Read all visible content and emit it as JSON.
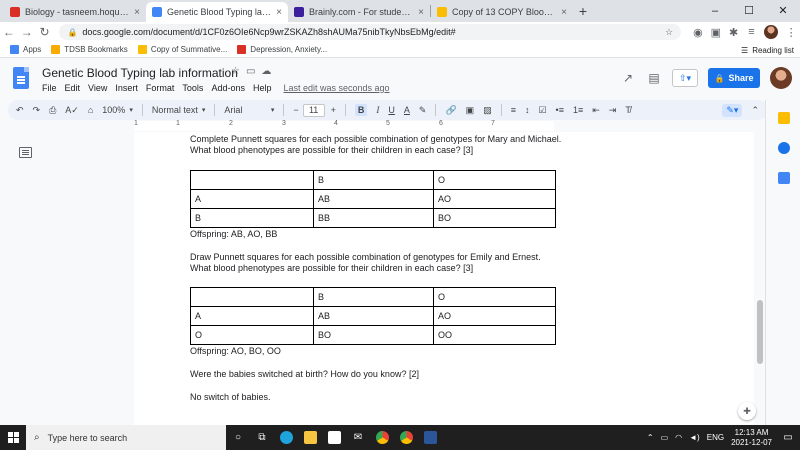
{
  "browser": {
    "tabs": [
      {
        "title": "Biology - tasneem.hoque@stude...",
        "active": false,
        "favicon_color": "#d93025"
      },
      {
        "title": "Genetic Blood Typing lab inform...",
        "active": true,
        "favicon_color": "#4285f4"
      },
      {
        "title": "Brainly.com - For students. By st...",
        "active": false,
        "favicon_color": "#3b1f9c"
      },
      {
        "title": "Copy of 13 COPY Blood typing la...",
        "active": false,
        "favicon_color": "#fbbc04"
      }
    ],
    "close_glyph": "×",
    "new_tab_glyph": "+",
    "window_controls": [
      "–",
      "☐",
      "✕"
    ],
    "url": "docs.google.com/document/d/1CF0z6OIe6Ncp9wrZSKAZh8shAUMa75nibTkyNbsEbMg/edit#",
    "bookmarks": [
      {
        "label": "Apps",
        "icon_color": "#4285f4"
      },
      {
        "label": "TDSB Bookmarks",
        "icon_color": "#f9ab00"
      },
      {
        "label": "Copy of Summative...",
        "icon_color": "#fbbc04"
      },
      {
        "label": "Depression, Anxiety...",
        "icon_color": "#d93025"
      }
    ],
    "reading_list": "Reading list"
  },
  "docs": {
    "title": "Genetic Blood Typing lab information",
    "menu": [
      "File",
      "Edit",
      "View",
      "Insert",
      "Format",
      "Tools",
      "Add-ons",
      "Help"
    ],
    "last_edit": "Last edit was seconds ago",
    "share_label": "Share",
    "accent_color": "#1a73e8"
  },
  "toolbar": {
    "zoom": "100%",
    "style": "Normal text",
    "font": "Arial",
    "font_size": "11",
    "bold": "B",
    "italic": "I",
    "underline": "U",
    "text_color": "A"
  },
  "ruler": {
    "numbers": [
      "1",
      "1",
      "2",
      "3",
      "4",
      "5",
      "6",
      "7"
    ]
  },
  "document": {
    "q1": "Complete Punnett squares for each possible combination of genotypes for Mary and Michael. What blood phenotypes are possible for their children in each case? [3]",
    "table1": [
      [
        "",
        "B",
        "O"
      ],
      [
        "A",
        "AB",
        "AO"
      ],
      [
        "B",
        "BB",
        "BO"
      ]
    ],
    "offspring1": "Offspring: AB, AO, BB",
    "q2": "Draw Punnett squares for each possible combination of genotypes for Emily and Ernest. What blood phenotypes are possible for their children in each case? [3]",
    "table2": [
      [
        "",
        "B",
        "O"
      ],
      [
        "A",
        "AB",
        "AO"
      ],
      [
        "O",
        "BO",
        "OO"
      ]
    ],
    "offspring2": "Offspring: AO, BO, OO",
    "q3": "Were the babies switched at birth? How do you know? [2]",
    "answer3": "No switch of babies."
  },
  "taskbar": {
    "search_placeholder": "Type here to search",
    "language": "ENG",
    "time": "12:13 AM",
    "date": "2021-12-07"
  }
}
